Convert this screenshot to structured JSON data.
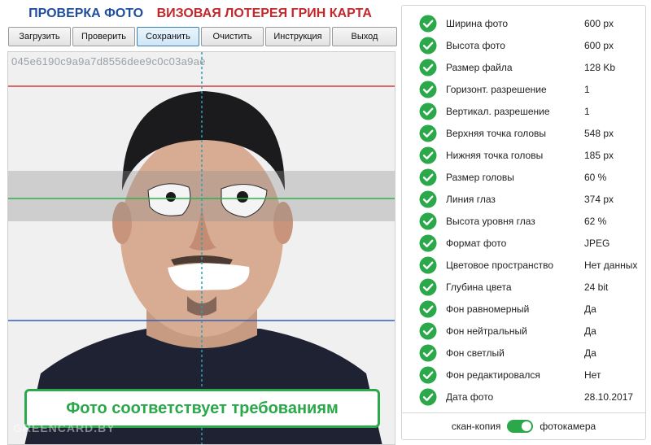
{
  "header": {
    "part1": "ПРОВЕРКА ФОТО",
    "part1_color": "#1f4e9c",
    "part2": "ВИЗОВАЯ ЛОТЕРЕЯ ГРИН КАРТА",
    "part2_color": "#c0282c"
  },
  "toolbar": {
    "load": "Загрузить",
    "check": "Проверить",
    "save": "Сохранить",
    "clear": "Очистить",
    "instructions": "Инструкция",
    "exit": "Выход"
  },
  "photo": {
    "hash": "045e6190c9a9a7d8556dee9c0c03a9ae",
    "status": "Фото соответствует требованиям",
    "watermark": "GREENCARD.BY"
  },
  "params": [
    {
      "label": "Ширина фото",
      "value": "600 px",
      "ok": true
    },
    {
      "label": "Высота фото",
      "value": "600 px",
      "ok": true
    },
    {
      "label": "Размер файла",
      "value": "128 Kb",
      "ok": true
    },
    {
      "label": "Горизонт. разрешение",
      "value": "1",
      "ok": true
    },
    {
      "label": "Вертикал. разрешение",
      "value": "1",
      "ok": true
    },
    {
      "label": "Верхняя точка головы",
      "value": "548 px",
      "ok": true
    },
    {
      "label": "Нижняя точка головы",
      "value": "185 px",
      "ok": true
    },
    {
      "label": "Размер головы",
      "value": "60 %",
      "ok": true
    },
    {
      "label": "Линия глаз",
      "value": "374 px",
      "ok": true
    },
    {
      "label": "Высота уровня глаз",
      "value": "62 %",
      "ok": true
    },
    {
      "label": "Формат фото",
      "value": "JPEG",
      "ok": true
    },
    {
      "label": "Цветовое пространство",
      "value": "Нет данных",
      "ok": true
    },
    {
      "label": "Глубина цвета",
      "value": "24 bit",
      "ok": true
    },
    {
      "label": "Фон равномерный",
      "value": "Да",
      "ok": true
    },
    {
      "label": "Фон нейтральный",
      "value": "Да",
      "ok": true
    },
    {
      "label": "Фон светлый",
      "value": "Да",
      "ok": true
    },
    {
      "label": "Фон редактировался",
      "value": "Нет",
      "ok": true
    },
    {
      "label": "Дата фото",
      "value": "28.10.2017",
      "ok": true
    }
  ],
  "footer": {
    "left_label": "скан-копия",
    "right_label": "фотокамера",
    "toggle_on": true
  },
  "colors": {
    "ok_green": "#2aa84a",
    "top_line": "#d23c3c",
    "eye_line": "#2fb04a",
    "chin_line": "#2f5fbf",
    "center_line": "#2aa0b8"
  }
}
